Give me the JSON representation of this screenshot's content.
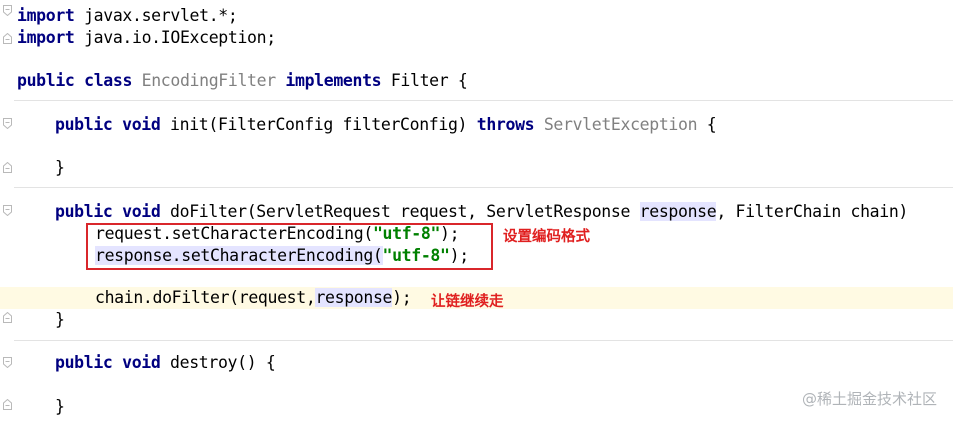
{
  "code": {
    "lines": {
      "l1": {
        "kw": "import",
        "rest": " javax.servlet.*;"
      },
      "l2": {
        "kw": "import",
        "rest": " java.io.IOException;"
      },
      "l3": {
        "kw1": "public",
        "kw2": "class",
        "cls": "EncodingFilter",
        "kw3": "implements",
        "rest": " Filter {"
      },
      "l4": {
        "kw1": "public",
        "kw2": "void",
        "mid": " init(FilterConfig filterConfig) ",
        "kw3": "throws",
        "exc": "ServletException",
        "end": " {"
      },
      "l5": {
        "text": "}"
      },
      "l6": {
        "kw1": "public",
        "kw2": "void",
        "a": " doFilter(ServletRequest request, ServletResponse ",
        "param": "response",
        "b": ", FilterChain chain)"
      },
      "l7": {
        "a": "request.setCharacterEncoding(",
        "str": "\"utf-8\"",
        "b": ");"
      },
      "l8": {
        "a": "response.setCharacterEncoding(",
        "str": "\"utf-8\"",
        "b": ");"
      },
      "l9": {
        "a": "chain.doFilter(request,",
        "param": "response",
        "b": ");"
      },
      "l10": {
        "text": "}"
      },
      "l11": {
        "kw1": "public",
        "kw2": "void",
        "rest": " destroy() {"
      },
      "l12": {
        "text": "}"
      }
    }
  },
  "annotations": {
    "encoding_note": "设置编码格式",
    "chain_note": "让链继续走"
  },
  "watermark": "@稀土掘金技术社区",
  "colors": {
    "keyword": "#000080",
    "string": "#008000",
    "annotation": "#e02020",
    "current_line": "#fffae3"
  }
}
